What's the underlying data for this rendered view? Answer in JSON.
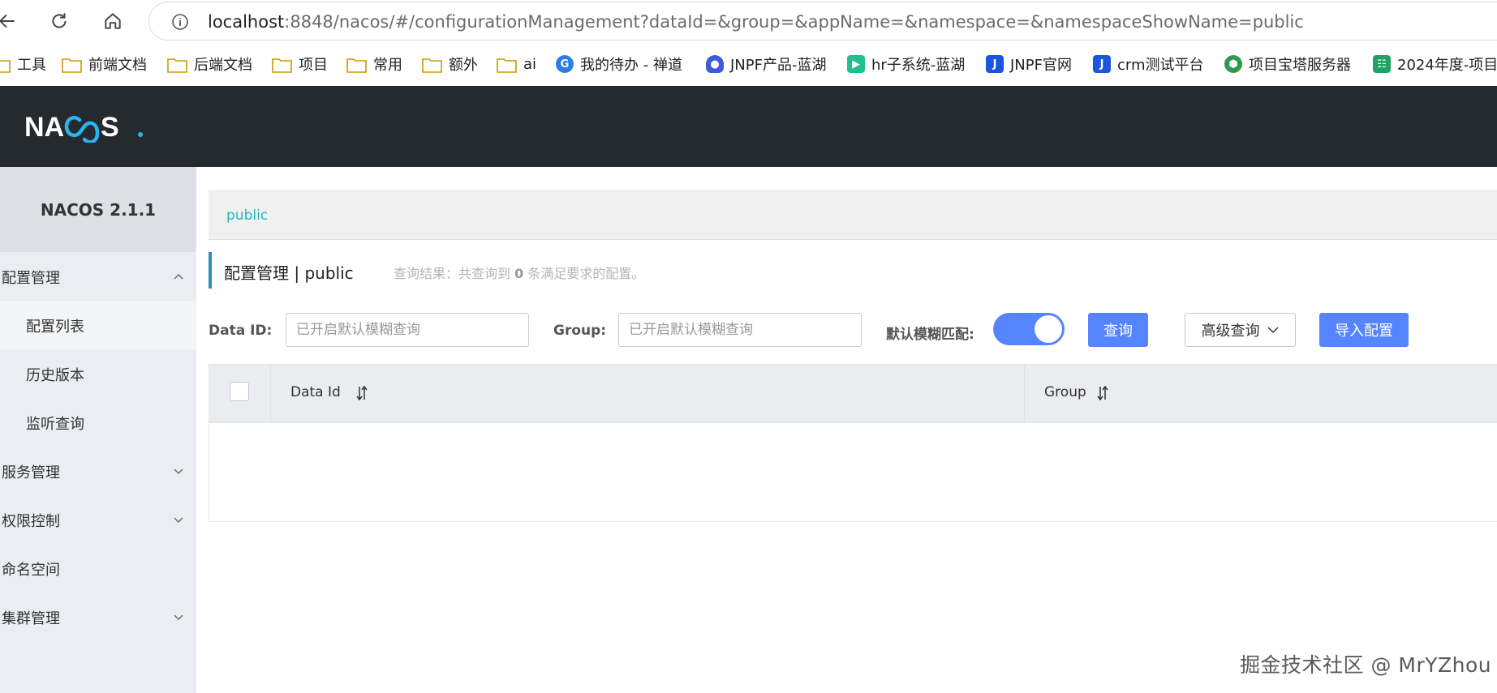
{
  "browser": {
    "url_host": "localhost",
    "url_rest": ":8848/nacos/#/configurationManagement?dataId=&group=&appName=&namespace=&namespaceShowName=public",
    "bookmarks": [
      {
        "label": "工具",
        "icon": "folder-icon"
      },
      {
        "label": "前端文档",
        "icon": "folder-icon"
      },
      {
        "label": "后端文档",
        "icon": "folder-icon"
      },
      {
        "label": "项目",
        "icon": "folder-icon"
      },
      {
        "label": "常用",
        "icon": "folder-icon"
      },
      {
        "label": "额外",
        "icon": "folder-icon"
      },
      {
        "label": "ai",
        "icon": "folder-icon"
      },
      {
        "label": "我的待办 - 禅道",
        "icon": "zentao-favicon"
      },
      {
        "label": "JNPF产品-蓝湖",
        "icon": "lanhu-favicon"
      },
      {
        "label": "hr子系统-蓝湖",
        "icon": "play-favicon"
      },
      {
        "label": "JNPF官网",
        "icon": "jnpf-favicon"
      },
      {
        "label": "crm测试平台",
        "icon": "jnpf-favicon"
      },
      {
        "label": "项目宝塔服务器",
        "icon": "baota-favicon"
      },
      {
        "label": "2024年度-项目",
        "icon": "sheet-favicon"
      }
    ]
  },
  "header": {
    "logo_text": "NACOS."
  },
  "sidebar": {
    "version": "NACOS 2.1.1",
    "items": [
      {
        "label": "配置管理",
        "type": "parent",
        "chevron": "up"
      },
      {
        "label": "配置列表",
        "type": "child",
        "active": true
      },
      {
        "label": "历史版本",
        "type": "child"
      },
      {
        "label": "监听查询",
        "type": "child"
      },
      {
        "label": "服务管理",
        "type": "parent",
        "chevron": "down"
      },
      {
        "label": "权限控制",
        "type": "parent",
        "chevron": "down"
      },
      {
        "label": "命名空间",
        "type": "parent"
      },
      {
        "label": "集群管理",
        "type": "parent",
        "chevron": "down"
      }
    ]
  },
  "main": {
    "namespace_tab": "public",
    "page_title": "配置管理 | public",
    "result_prefix": "查询结果：共查询到 ",
    "result_count": "0",
    "result_suffix": " 条满足要求的配置。",
    "filters": {
      "data_id_label": "Data ID:",
      "data_id_placeholder": "已开启默认模糊查询",
      "group_label": "Group:",
      "group_placeholder": "已开启默认模糊查询",
      "fuzzy_label": "默认模糊匹配:",
      "fuzzy_enabled": true,
      "query_button": "查询",
      "advanced_button": "高级查询",
      "import_button": "导入配置"
    },
    "table": {
      "columns": [
        "Data Id",
        "Group"
      ]
    }
  },
  "watermark": "掘金技术社区 @ MrYZhou",
  "colors": {
    "header_bg": "#252a2f",
    "primary": "#5584ff",
    "link": "#1fb6c8",
    "sidebar_bg": "#eaedf1"
  }
}
